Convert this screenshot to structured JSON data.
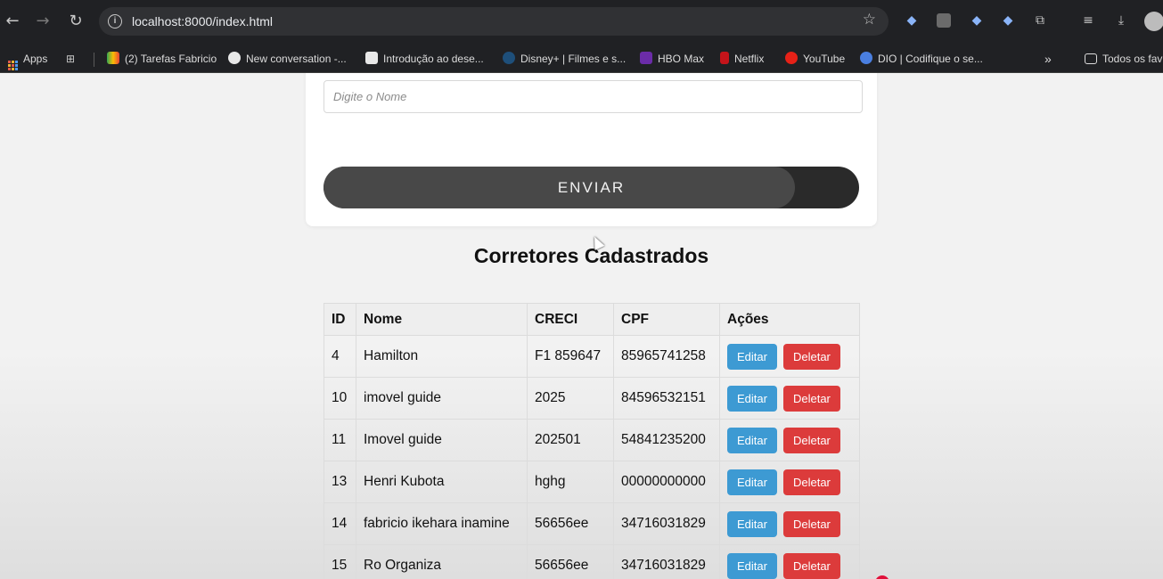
{
  "browser": {
    "url": "localhost:8000/index.html",
    "bookmarks": [
      {
        "label": "Apps",
        "icon": "apps-grid-icon"
      },
      {
        "label": "(2) Tarefas Fabricio",
        "icon": "drive-icon"
      },
      {
        "label": "New conversation -...",
        "icon": "github-icon"
      },
      {
        "label": "Introdução ao dese...",
        "icon": "page-icon"
      },
      {
        "label": "Disney+ | Filmes e s...",
        "icon": "disney-icon"
      },
      {
        "label": "HBO Max",
        "icon": "hbo-icon"
      },
      {
        "label": "Netflix",
        "icon": "netflix-icon"
      },
      {
        "label": "YouTube",
        "icon": "youtube-icon"
      },
      {
        "label": "DIO | Codifique o se...",
        "icon": "dio-icon"
      }
    ],
    "overflow_label": "»",
    "all_bookmarks_label": "Todos os fav"
  },
  "form": {
    "name_placeholder": "Digite o Nome",
    "submit_label": "ENVIAR"
  },
  "list": {
    "title": "Corretores Cadastrados",
    "headers": [
      "ID",
      "Nome",
      "CRECI",
      "CPF",
      "Ações"
    ],
    "edit_label": "Editar",
    "delete_label": "Deletar",
    "rows": [
      {
        "id": "4",
        "nome": "Hamilton",
        "creci": "F1 859647",
        "cpf": "85965741258"
      },
      {
        "id": "10",
        "nome": "imovel guide",
        "creci": "2025",
        "cpf": "84596532151"
      },
      {
        "id": "11",
        "nome": "Imovel guide",
        "creci": "202501",
        "cpf": "54841235200"
      },
      {
        "id": "13",
        "nome": "Henri Kubota",
        "creci": "hghg",
        "cpf": "00000000000"
      },
      {
        "id": "14",
        "nome": "fabricio ikehara inamine",
        "creci": "56656ee",
        "cpf": "34716031829"
      },
      {
        "id": "15",
        "nome": "Ro Organiza",
        "creci": "56656ee",
        "cpf": "34716031829"
      }
    ]
  },
  "colors": {
    "edit_button": "#3d9ad3",
    "delete_button": "#dc3b3b",
    "submit_button": "#2a2a2a"
  }
}
